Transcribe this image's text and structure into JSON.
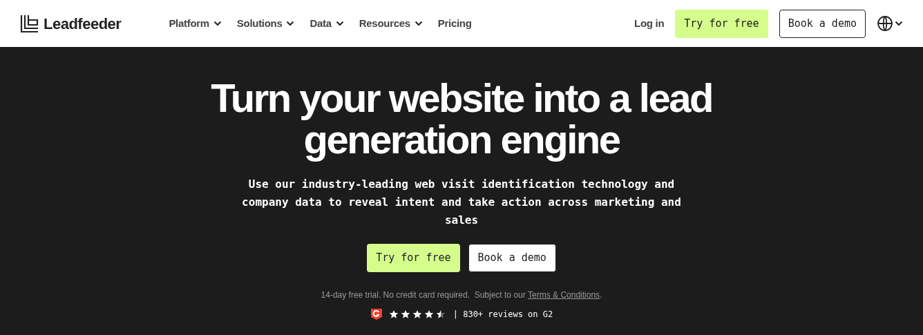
{
  "header": {
    "logo": "Leadfeeder",
    "nav": [
      {
        "label": "Platform",
        "dropdown": true
      },
      {
        "label": "Solutions",
        "dropdown": true
      },
      {
        "label": "Data",
        "dropdown": true
      },
      {
        "label": "Resources",
        "dropdown": true
      },
      {
        "label": "Pricing",
        "dropdown": false
      }
    ],
    "login": "Log in",
    "primary_button": "Try for free",
    "secondary_button": "Book a demo"
  },
  "hero": {
    "title": "Turn your website into a lead generation engine",
    "subtitle": "Use our industry-leading web visit identification technology and company data to reveal intent and take action across marketing and sales",
    "primary_button": "Try for free",
    "secondary_button": "Book a demo",
    "note": "14-day free trial. No credit card required.  Subject to our ",
    "terms_link": "Terms & Conditions",
    "note_end": ".",
    "rating": {
      "stars": 4.5,
      "text": "| 830+ reviews on G2"
    }
  }
}
